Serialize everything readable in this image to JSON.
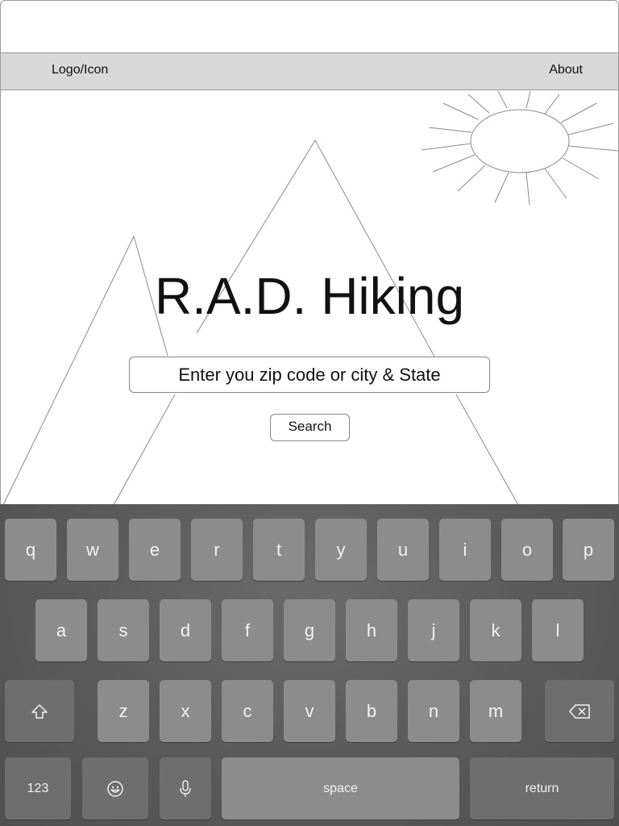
{
  "nav": {
    "logo_label": "Logo/Icon",
    "about_label": "About"
  },
  "hero": {
    "title": "R.A.D. Hiking",
    "search_placeholder": "Enter you zip code or city & State",
    "search_button": "Search"
  },
  "keyboard": {
    "row1": [
      "q",
      "w",
      "e",
      "r",
      "t",
      "y",
      "u",
      "i",
      "o",
      "p"
    ],
    "row2": [
      "a",
      "s",
      "d",
      "f",
      "g",
      "h",
      "j",
      "k",
      "l"
    ],
    "row3": [
      "z",
      "x",
      "c",
      "v",
      "b",
      "n",
      "m"
    ],
    "shift_icon": "shift-icon",
    "backspace_icon": "backspace-icon",
    "numbers_label": "123",
    "emoji_icon": "emoji-icon",
    "mic_icon": "microphone-icon",
    "space_label": "space",
    "return_label": "return"
  }
}
